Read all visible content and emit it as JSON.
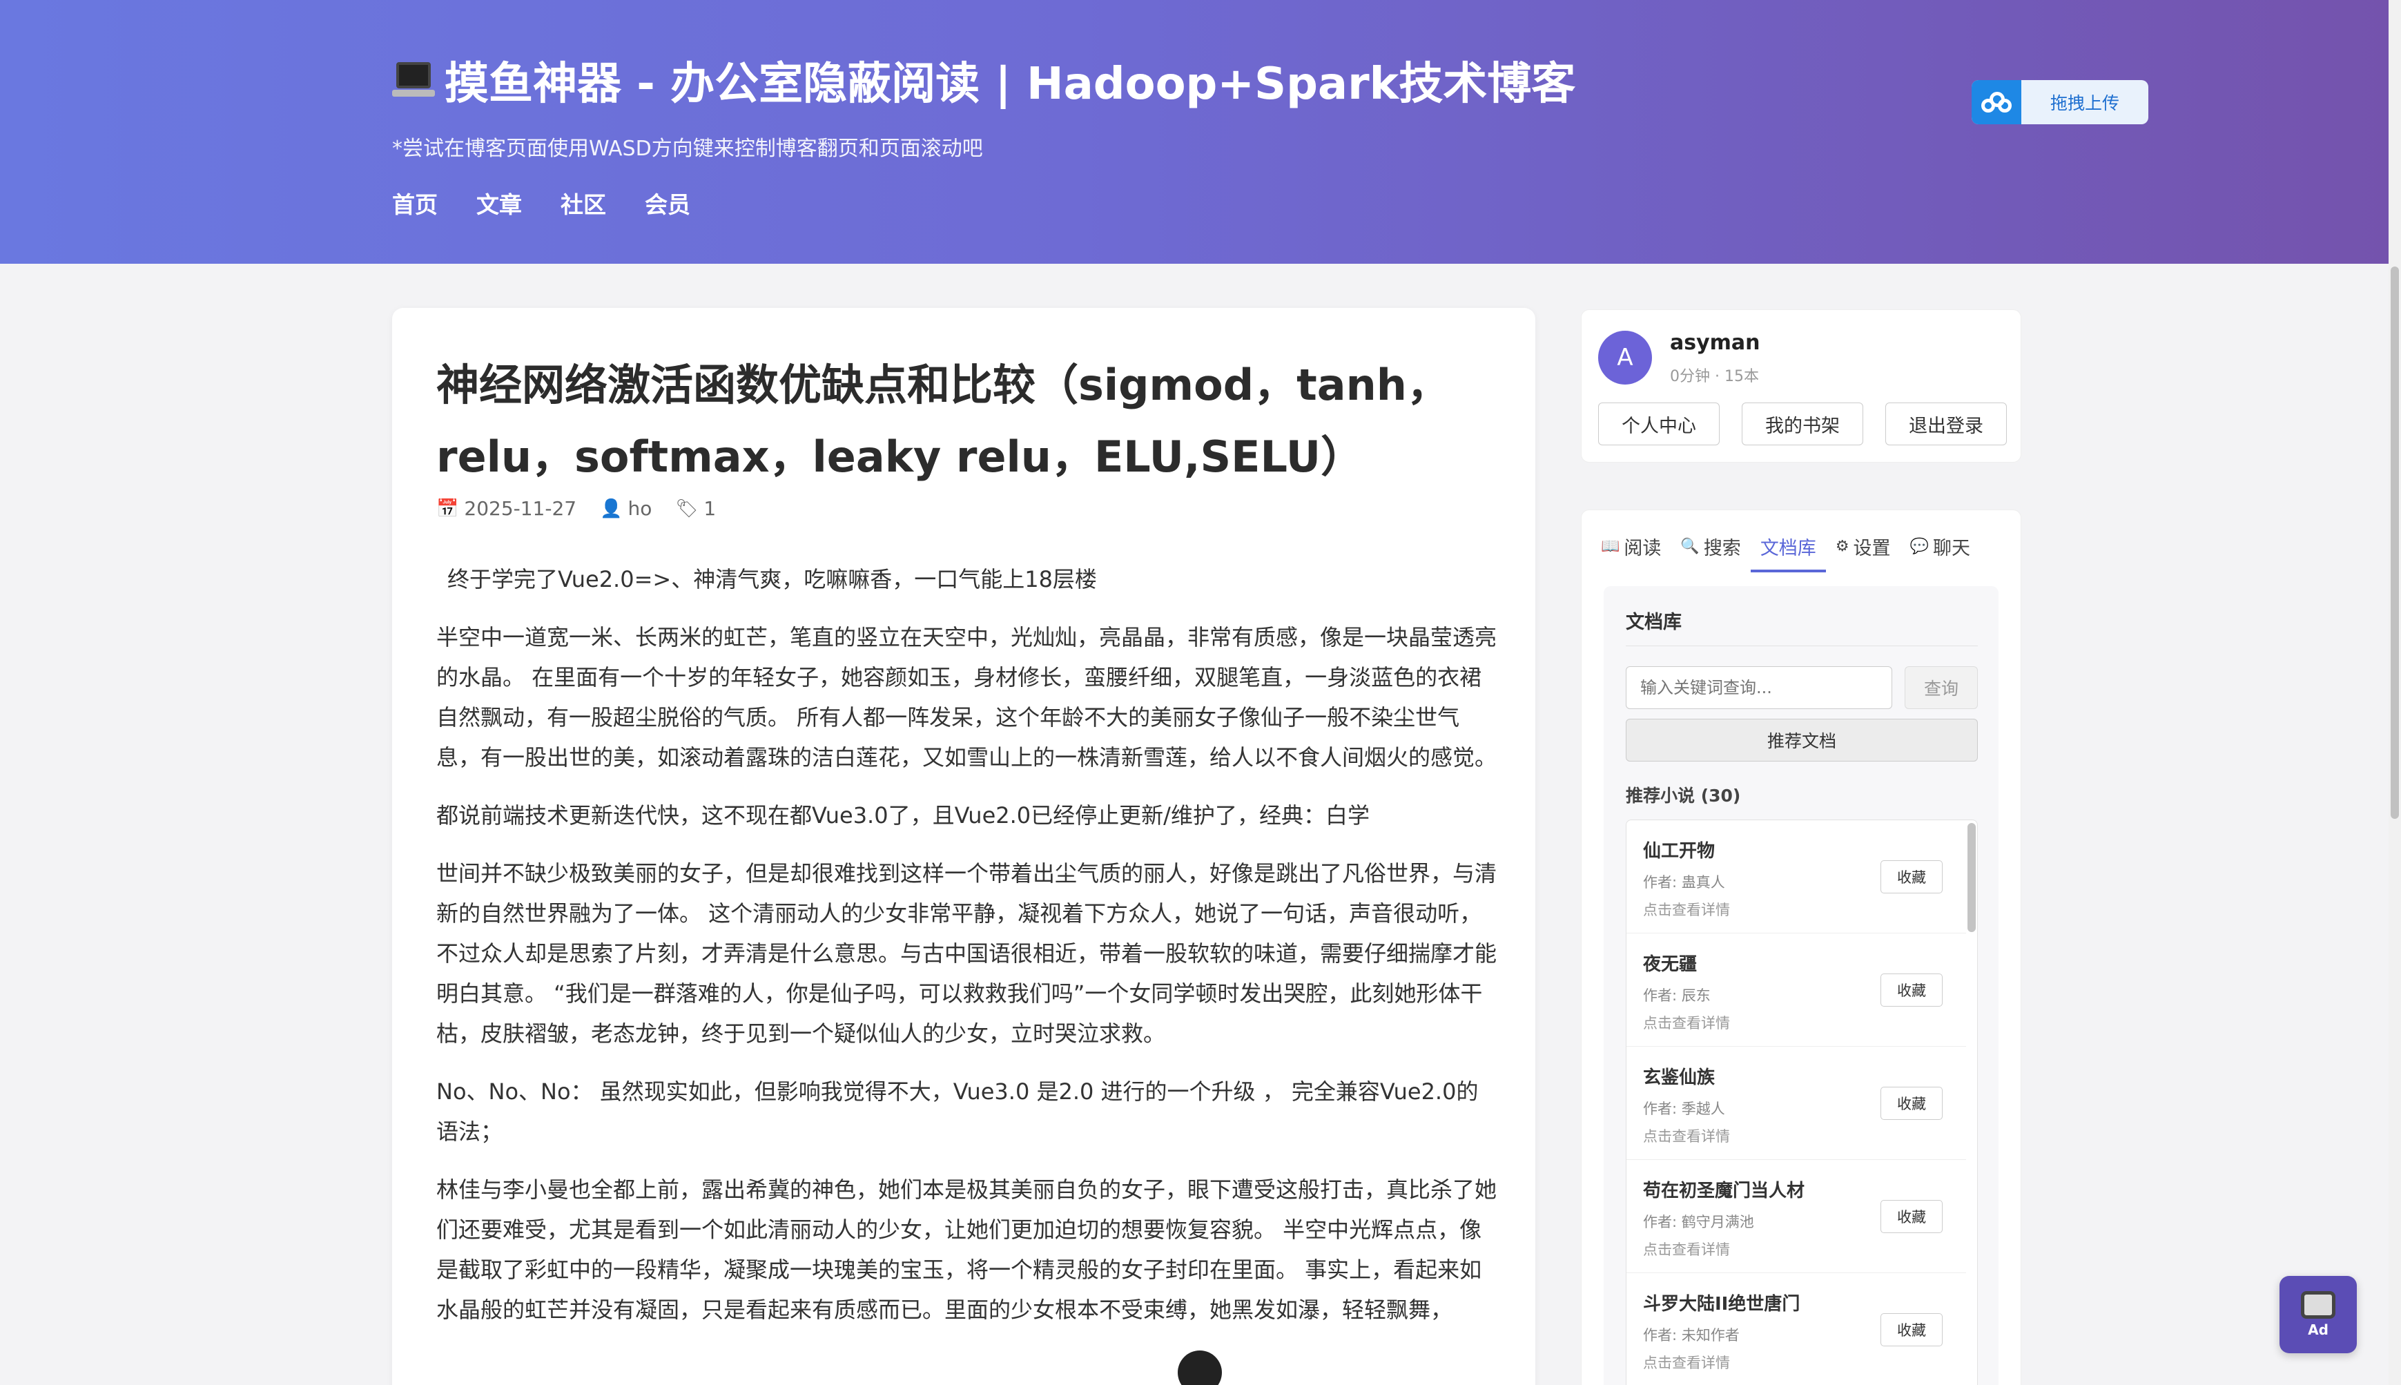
{
  "header": {
    "site_title": "摸鱼神器 - 办公室隐蔽阅读 | Hadoop+Spark技术博客",
    "subtitle": "*尝试在博客页面使用WASD方向键来控制博客翻页和页面滚动吧",
    "nav": [
      "首页",
      "文章",
      "社区",
      "会员"
    ],
    "upload_label": "拖拽上传"
  },
  "article": {
    "title": "神经网络激活函数优缺点和比较（sigmod，tanh，relu，softmax，leaky relu，ELU,SELU）",
    "date": "2025-11-27",
    "author": "ho",
    "tag_count": "1",
    "paragraphs": [
      "终于学完了Vue2.0=>、神清气爽，吃嘛嘛香，一口气能上18层楼",
      "半空中一道宽一米、长两米的虹芒，笔直的竖立在天空中，光灿灿，亮晶晶，非常有质感，像是一块晶莹透亮的水晶。 在里面有一个十岁的年轻女子，她容颜如玉，身材修长，蛮腰纤细，双腿笔直，一身淡蓝色的衣裙自然飘动，有一股超尘脱俗的气质。 所有人都一阵发呆，这个年龄不大的美丽女子像仙子一般不染尘世气息，有一股出世的美，如滚动着露珠的洁白莲花，又如雪山上的一株清新雪莲，给人以不食人间烟火的感觉。",
      "都说前端技术更新迭代快，这不现在都Vue3.0了，且Vue2.0已经停止更新/维护了，经典：白学",
      "世间并不缺少极致美丽的女子，但是却很难找到这样一个带着出尘气质的丽人，好像是跳出了凡俗世界，与清新的自然世界融为了一体。 这个清丽动人的少女非常平静，凝视着下方众人，她说了一句话，声音很动听，不过众人却是思索了片刻，才弄清是什么意思。与古中国语很相近，带着一股软软的味道，需要仔细揣摩才能明白其意。 “我们是一群落难的人，你是仙子吗，可以救救我们吗”一个女同学顿时发出哭腔，此刻她形体干枯，皮肤褶皱，老态龙钟，终于见到一个疑似仙人的少女，立时哭泣求救。",
      "No、No、No： 虽然现实如此，但影响我觉得不大，Vue3.0 是2.0 进行的一个升级 ， 完全兼容Vue2.0的语法；",
      "林佳与李小曼也全都上前，露出希冀的神色，她们本是极其美丽自负的女子，眼下遭受这般打击，真比杀了她们还要难受，尤其是看到一个如此清丽动人的少女，让她们更加迫切的想要恢复容貌。 半空中光辉点点，像是截取了彩虹中的一段精华，凝聚成一块瑰美的宝玉，将一个精灵般的女子封印在里面。 事实上，看起来如水晶般的虹芒并没有凝固，只是看起来有质感而已。里面的少女根本不受束缚，她黑发如瀑，轻轻飘舞，"
    ]
  },
  "user": {
    "avatar_letter": "A",
    "name": "asyman",
    "stats": "0分钟 · 15本",
    "buttons": [
      "个人中心",
      "我的书架",
      "退出登录"
    ]
  },
  "panel": {
    "tabs": [
      {
        "icon": "📖",
        "label": "阅读"
      },
      {
        "icon": "🔍",
        "label": "搜索"
      },
      {
        "icon": "",
        "label": "文档库"
      },
      {
        "icon": "⚙",
        "label": "设置"
      },
      {
        "icon": "💬",
        "label": "聊天"
      }
    ],
    "active_tab": "文档库",
    "section_title": "文档库",
    "search_placeholder": "输入关键词查询...",
    "query_label": "查询",
    "recommend_button": "推荐文档",
    "recommend_count": "推荐小说 (30)",
    "items": [
      {
        "title": "仙工开物",
        "author": "作者: 蛊真人",
        "detail": "点击查看详情",
        "fav": "收藏"
      },
      {
        "title": "夜无疆",
        "author": "作者: 辰东",
        "detail": "点击查看详情",
        "fav": "收藏"
      },
      {
        "title": "玄鉴仙族",
        "author": "作者: 季越人",
        "detail": "点击查看详情",
        "fav": "收藏"
      },
      {
        "title": "苟在初圣魔门当人材",
        "author": "作者: 鹤守月满池",
        "detail": "点击查看详情",
        "fav": "收藏"
      },
      {
        "title": "斗罗大陆II绝世唐门",
        "author": "作者: 未知作者",
        "detail": "点击查看详情",
        "fav": "收藏"
      }
    ]
  },
  "ad": {
    "label": "Ad"
  }
}
